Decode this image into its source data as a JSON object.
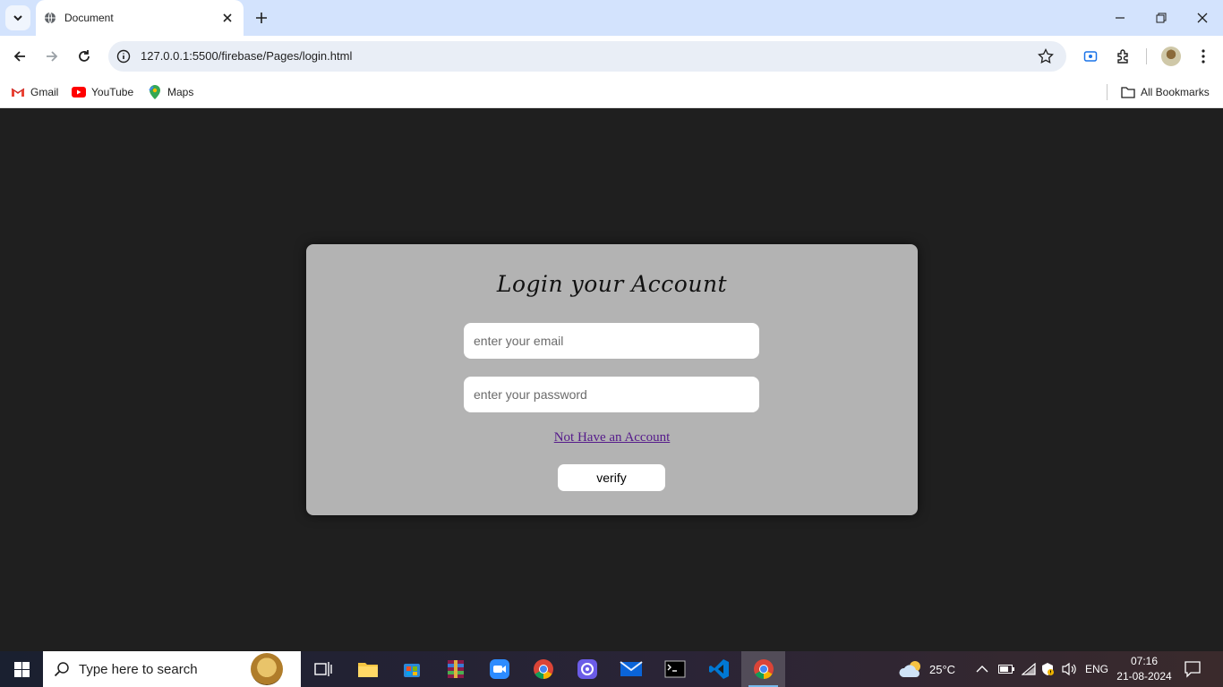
{
  "browser": {
    "tab_title": "Document",
    "url": "127.0.0.1:5500/firebase/Pages/login.html",
    "bookmarks": [
      {
        "label": "Gmail",
        "icon": "gmail-icon"
      },
      {
        "label": "YouTube",
        "icon": "youtube-icon"
      },
      {
        "label": "Maps",
        "icon": "maps-icon"
      }
    ],
    "all_bookmarks_label": "All Bookmarks"
  },
  "login": {
    "title": "Login your Account",
    "email_placeholder": "enter your email",
    "password_placeholder": "enter your password",
    "signup_link": "Not Have an Account",
    "verify_label": "verify"
  },
  "taskbar": {
    "search_placeholder": "Type here to search",
    "weather": "25°C",
    "language": "ENG",
    "time": "07:16",
    "date": "21-08-2024"
  },
  "colors": {
    "page_bg": "#1f1f1f",
    "card_bg": "#b3b3b3",
    "link": "#551a8b",
    "tabstrip": "#d3e3fd"
  }
}
